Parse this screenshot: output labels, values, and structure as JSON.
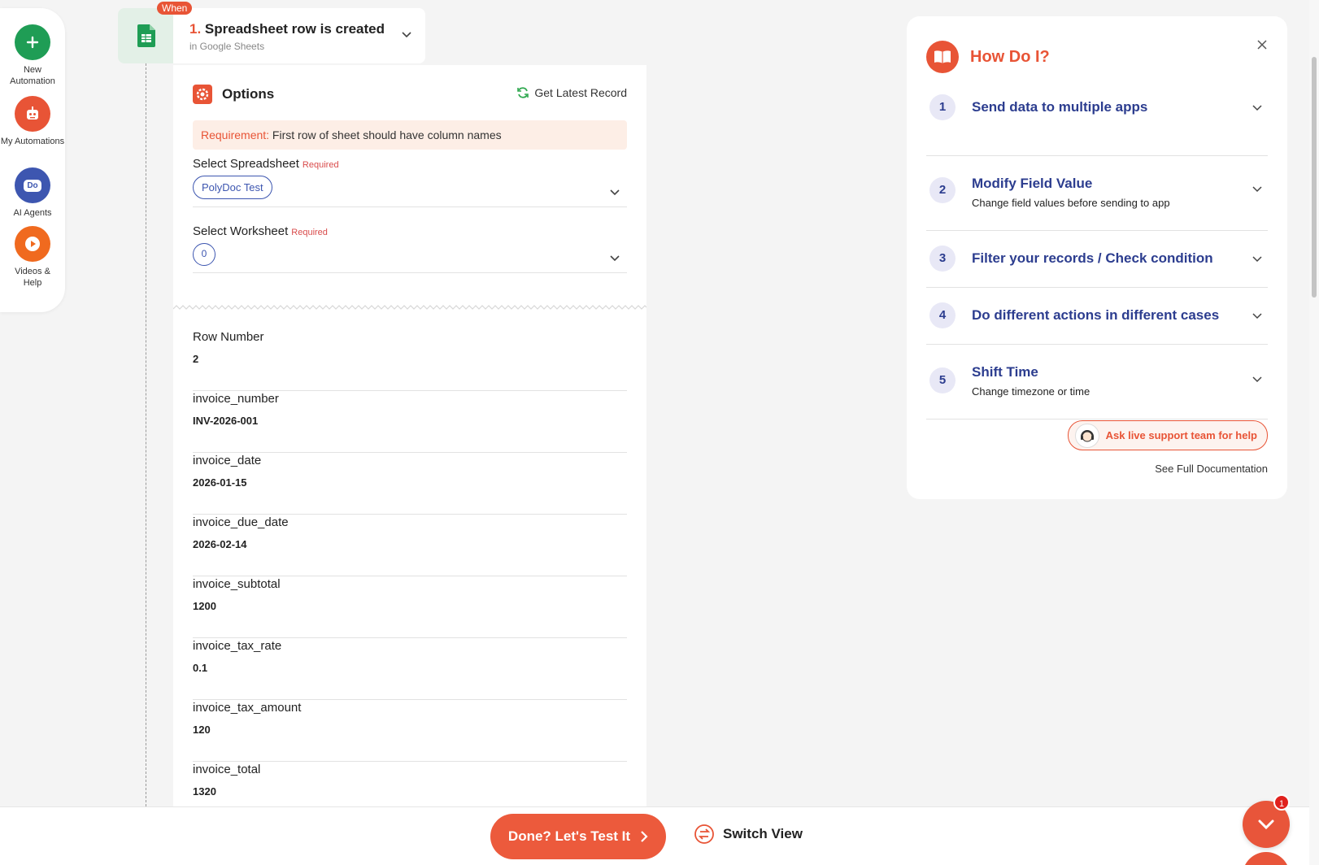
{
  "rail": {
    "items": [
      {
        "label": "New Automation",
        "icon": "plus-icon",
        "color": "#1f9d55"
      },
      {
        "label": "My Automations",
        "icon": "robot-icon",
        "color": "#e85436"
      },
      {
        "label": "AI Agents",
        "icon": "chat-icon",
        "color": "#3d56b0"
      },
      {
        "label": "Videos & Help",
        "icon": "play-icon",
        "color": "#f06a1f"
      }
    ],
    "ai_agents_glyph": "Do"
  },
  "trigger": {
    "badge": "When",
    "number": "1.",
    "title": "Spreadsheet row is created",
    "subtitle": "in Google Sheets"
  },
  "options": {
    "title": "Options",
    "latest_record": "Get Latest Record",
    "requirement_label": "Requirement:",
    "requirement_text": " First row of sheet should have column names",
    "spreadsheet_label": "Select Spreadsheet",
    "spreadsheet_required": "Required",
    "spreadsheet_value": "PolyDoc Test",
    "worksheet_label": "Select Worksheet",
    "worksheet_required": "Required",
    "worksheet_value": "0"
  },
  "fields": [
    {
      "name": "Row Number",
      "value": "2"
    },
    {
      "name": "invoice_number",
      "value": "INV-2026-001"
    },
    {
      "name": "invoice_date",
      "value": "2026-01-15"
    },
    {
      "name": "invoice_due_date",
      "value": "2026-02-14"
    },
    {
      "name": "invoice_subtotal",
      "value": "1200"
    },
    {
      "name": "invoice_tax_rate",
      "value": "0.1"
    },
    {
      "name": "invoice_tax_amount",
      "value": "120"
    },
    {
      "name": "invoice_total",
      "value": "1320"
    }
  ],
  "help": {
    "title": "How Do I?",
    "items": [
      {
        "num": "1",
        "title": "Send data to multiple apps",
        "sub": ""
      },
      {
        "num": "2",
        "title": "Modify Field Value",
        "sub": "Change field values before sending to app"
      },
      {
        "num": "3",
        "title": "Filter your records / Check condition",
        "sub": ""
      },
      {
        "num": "4",
        "title": "Do different actions in different cases",
        "sub": ""
      },
      {
        "num": "5",
        "title": "Shift Time",
        "sub": "Change timezone or time"
      }
    ],
    "support_label": "Ask live support team for help",
    "docs_label": "See Full Documentation"
  },
  "bottom": {
    "test_label": "Done? Let's Test It",
    "switch_label": "Switch View"
  },
  "fab": {
    "badge": "1"
  },
  "colors": {
    "accent": "#e85436",
    "brand_blue": "#2c3d8f",
    "sheets_green": "#1f9d55"
  }
}
